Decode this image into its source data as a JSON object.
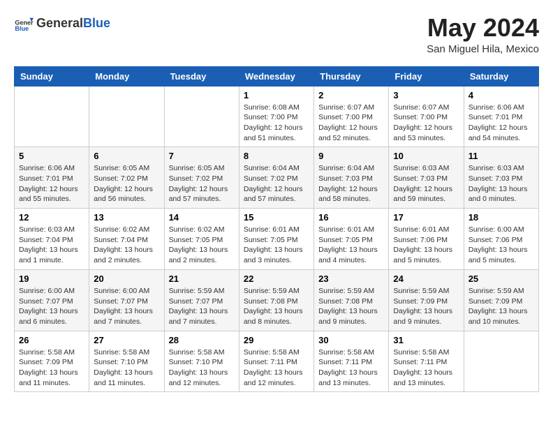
{
  "logo": {
    "general": "General",
    "blue": "Blue"
  },
  "title": "May 2024",
  "location": "San Miguel Hila, Mexico",
  "days_header": [
    "Sunday",
    "Monday",
    "Tuesday",
    "Wednesday",
    "Thursday",
    "Friday",
    "Saturday"
  ],
  "weeks": [
    [
      {
        "day": "",
        "info": ""
      },
      {
        "day": "",
        "info": ""
      },
      {
        "day": "",
        "info": ""
      },
      {
        "day": "1",
        "info": "Sunrise: 6:08 AM\nSunset: 7:00 PM\nDaylight: 12 hours and 51 minutes."
      },
      {
        "day": "2",
        "info": "Sunrise: 6:07 AM\nSunset: 7:00 PM\nDaylight: 12 hours and 52 minutes."
      },
      {
        "day": "3",
        "info": "Sunrise: 6:07 AM\nSunset: 7:00 PM\nDaylight: 12 hours and 53 minutes."
      },
      {
        "day": "4",
        "info": "Sunrise: 6:06 AM\nSunset: 7:01 PM\nDaylight: 12 hours and 54 minutes."
      }
    ],
    [
      {
        "day": "5",
        "info": "Sunrise: 6:06 AM\nSunset: 7:01 PM\nDaylight: 12 hours and 55 minutes."
      },
      {
        "day": "6",
        "info": "Sunrise: 6:05 AM\nSunset: 7:02 PM\nDaylight: 12 hours and 56 minutes."
      },
      {
        "day": "7",
        "info": "Sunrise: 6:05 AM\nSunset: 7:02 PM\nDaylight: 12 hours and 57 minutes."
      },
      {
        "day": "8",
        "info": "Sunrise: 6:04 AM\nSunset: 7:02 PM\nDaylight: 12 hours and 57 minutes."
      },
      {
        "day": "9",
        "info": "Sunrise: 6:04 AM\nSunset: 7:03 PM\nDaylight: 12 hours and 58 minutes."
      },
      {
        "day": "10",
        "info": "Sunrise: 6:03 AM\nSunset: 7:03 PM\nDaylight: 12 hours and 59 minutes."
      },
      {
        "day": "11",
        "info": "Sunrise: 6:03 AM\nSunset: 7:03 PM\nDaylight: 13 hours and 0 minutes."
      }
    ],
    [
      {
        "day": "12",
        "info": "Sunrise: 6:03 AM\nSunset: 7:04 PM\nDaylight: 13 hours and 1 minute."
      },
      {
        "day": "13",
        "info": "Sunrise: 6:02 AM\nSunset: 7:04 PM\nDaylight: 13 hours and 2 minutes."
      },
      {
        "day": "14",
        "info": "Sunrise: 6:02 AM\nSunset: 7:05 PM\nDaylight: 13 hours and 2 minutes."
      },
      {
        "day": "15",
        "info": "Sunrise: 6:01 AM\nSunset: 7:05 PM\nDaylight: 13 hours and 3 minutes."
      },
      {
        "day": "16",
        "info": "Sunrise: 6:01 AM\nSunset: 7:05 PM\nDaylight: 13 hours and 4 minutes."
      },
      {
        "day": "17",
        "info": "Sunrise: 6:01 AM\nSunset: 7:06 PM\nDaylight: 13 hours and 5 minutes."
      },
      {
        "day": "18",
        "info": "Sunrise: 6:00 AM\nSunset: 7:06 PM\nDaylight: 13 hours and 5 minutes."
      }
    ],
    [
      {
        "day": "19",
        "info": "Sunrise: 6:00 AM\nSunset: 7:07 PM\nDaylight: 13 hours and 6 minutes."
      },
      {
        "day": "20",
        "info": "Sunrise: 6:00 AM\nSunset: 7:07 PM\nDaylight: 13 hours and 7 minutes."
      },
      {
        "day": "21",
        "info": "Sunrise: 5:59 AM\nSunset: 7:07 PM\nDaylight: 13 hours and 7 minutes."
      },
      {
        "day": "22",
        "info": "Sunrise: 5:59 AM\nSunset: 7:08 PM\nDaylight: 13 hours and 8 minutes."
      },
      {
        "day": "23",
        "info": "Sunrise: 5:59 AM\nSunset: 7:08 PM\nDaylight: 13 hours and 9 minutes."
      },
      {
        "day": "24",
        "info": "Sunrise: 5:59 AM\nSunset: 7:09 PM\nDaylight: 13 hours and 9 minutes."
      },
      {
        "day": "25",
        "info": "Sunrise: 5:59 AM\nSunset: 7:09 PM\nDaylight: 13 hours and 10 minutes."
      }
    ],
    [
      {
        "day": "26",
        "info": "Sunrise: 5:58 AM\nSunset: 7:09 PM\nDaylight: 13 hours and 11 minutes."
      },
      {
        "day": "27",
        "info": "Sunrise: 5:58 AM\nSunset: 7:10 PM\nDaylight: 13 hours and 11 minutes."
      },
      {
        "day": "28",
        "info": "Sunrise: 5:58 AM\nSunset: 7:10 PM\nDaylight: 13 hours and 12 minutes."
      },
      {
        "day": "29",
        "info": "Sunrise: 5:58 AM\nSunset: 7:11 PM\nDaylight: 13 hours and 12 minutes."
      },
      {
        "day": "30",
        "info": "Sunrise: 5:58 AM\nSunset: 7:11 PM\nDaylight: 13 hours and 13 minutes."
      },
      {
        "day": "31",
        "info": "Sunrise: 5:58 AM\nSunset: 7:11 PM\nDaylight: 13 hours and 13 minutes."
      },
      {
        "day": "",
        "info": ""
      }
    ]
  ]
}
